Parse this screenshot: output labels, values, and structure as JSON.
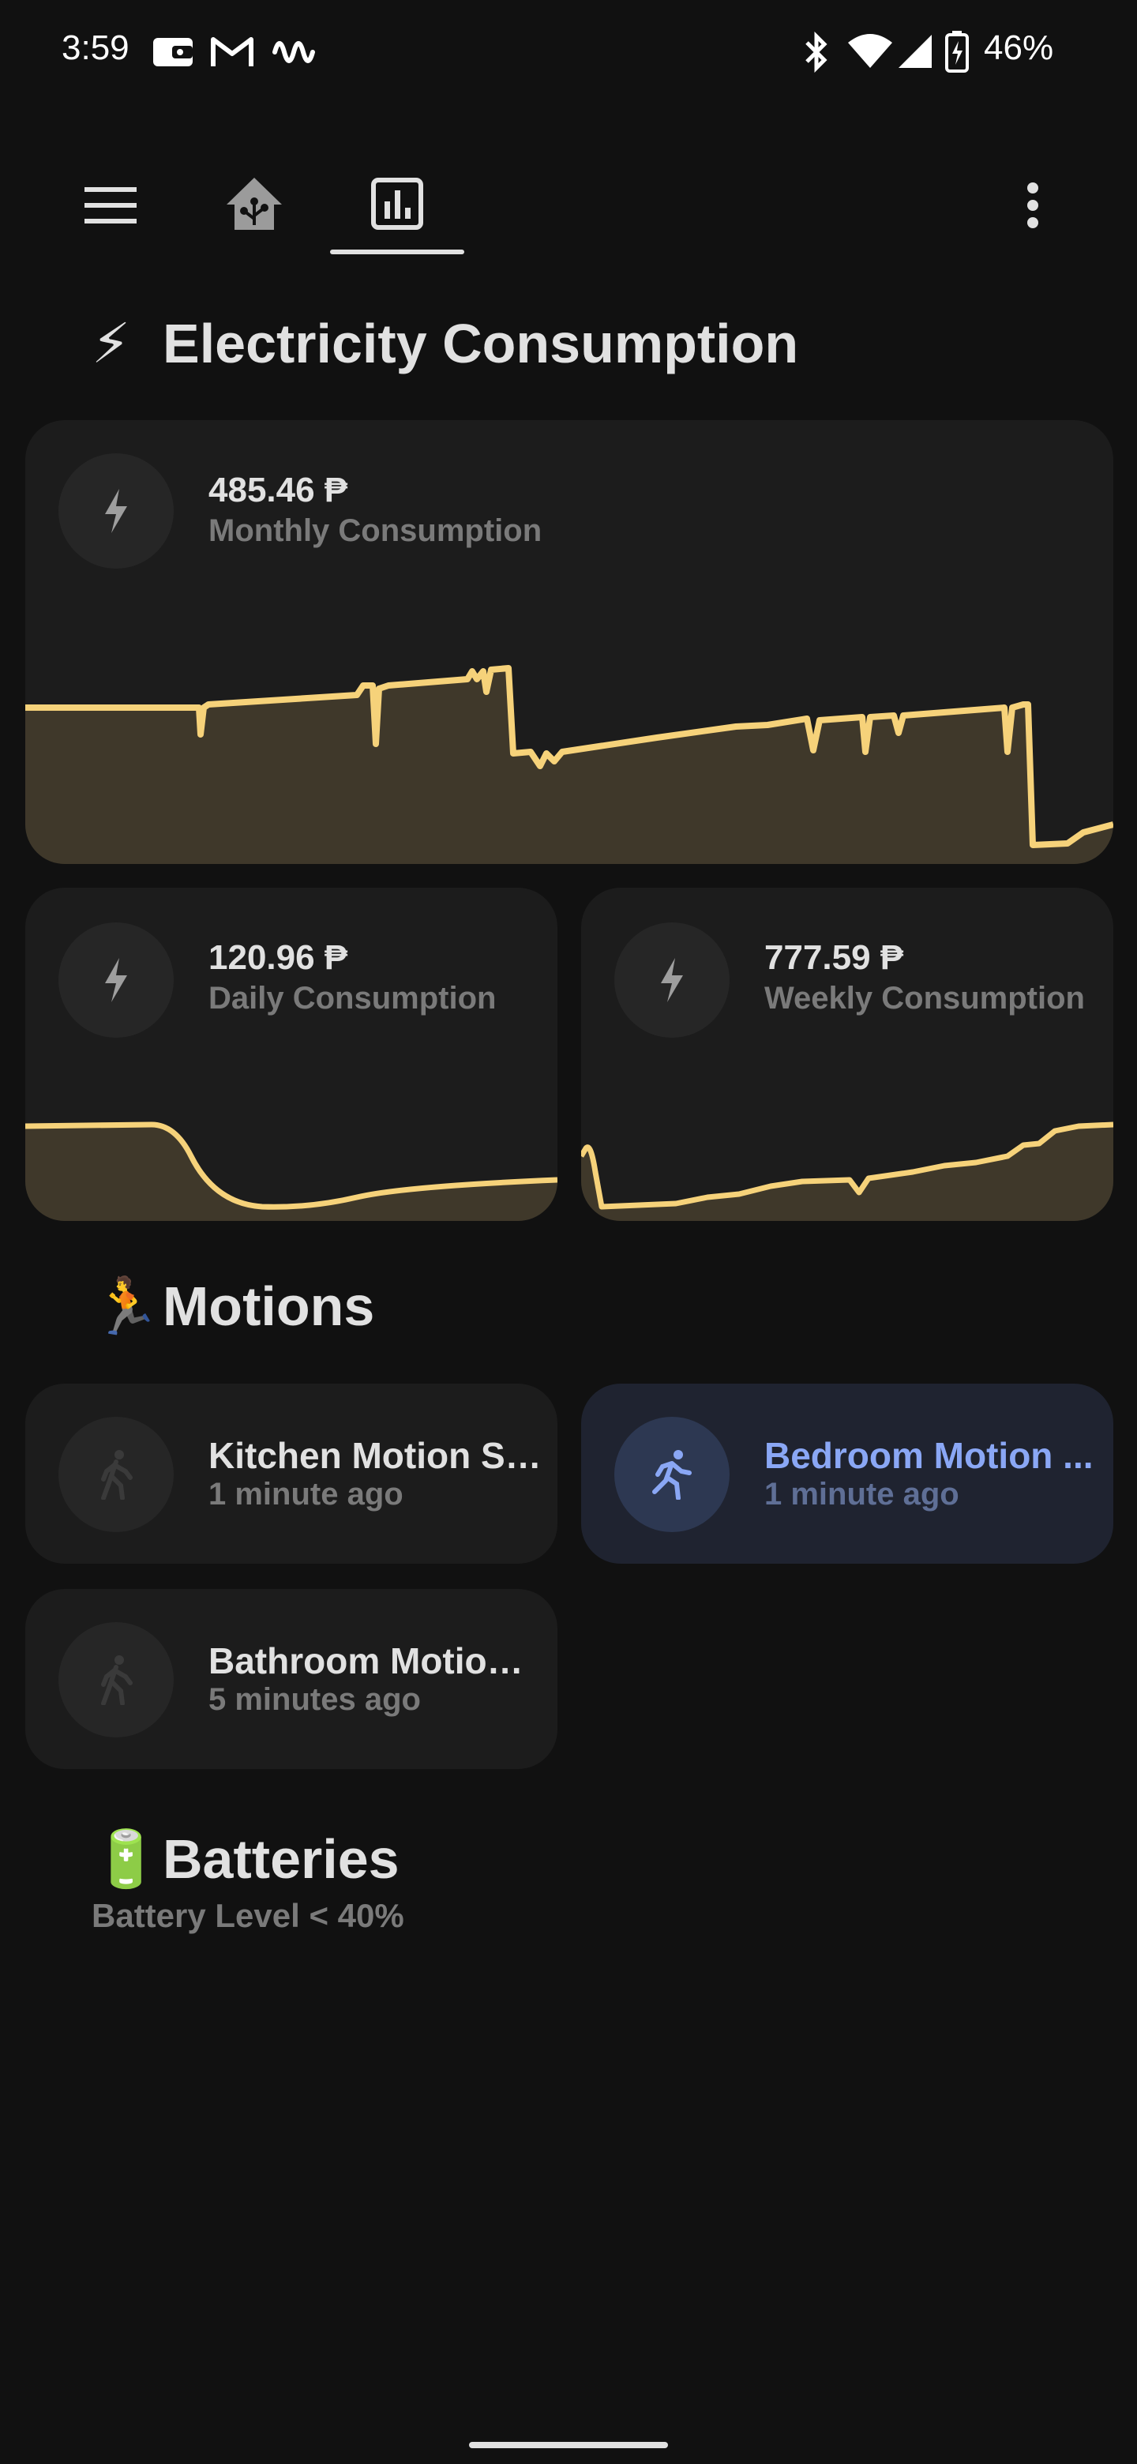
{
  "status_bar": {
    "time": "3:59",
    "battery_percent": "46%",
    "icons": [
      "wallet-icon",
      "gmail-icon",
      "assistant-icon",
      "bluetooth-icon",
      "wifi-icon",
      "signal-icon",
      "battery-charging-icon"
    ]
  },
  "toolbar": {
    "menu_icon": "hamburger-menu-icon",
    "tabs": [
      {
        "icon": "home-assistant-icon",
        "selected": false
      },
      {
        "icon": "chart-bar-icon",
        "selected": true
      }
    ],
    "overflow_icon": "more-vertical-icon"
  },
  "sections": {
    "electricity": {
      "emoji": "⚡",
      "title": "Electricity Consumption"
    },
    "motions": {
      "emoji": "🏃",
      "title": "Motions"
    },
    "batteries": {
      "emoji": "🔋",
      "title": "Batteries",
      "subtitle": "Battery Level < 40%"
    }
  },
  "electricity_cards": {
    "monthly": {
      "value": "485.46 ₱",
      "label": "Monthly Consumption",
      "icon": "lightning-bolt-icon"
    },
    "daily": {
      "value": "120.96 ₱",
      "label": "Daily Consumption",
      "icon": "lightning-bolt-icon"
    },
    "weekly": {
      "value": "777.59 ₱",
      "label": "Weekly Consumption",
      "icon": "lightning-bolt-icon"
    }
  },
  "motion_cards": [
    {
      "name": "Kitchen Motion Se...",
      "time": "1 minute ago",
      "active": false,
      "icon": "walk-icon"
    },
    {
      "name": "Bedroom Motion ...",
      "time": "1 minute ago",
      "active": true,
      "icon": "run-icon"
    },
    {
      "name": "Bathroom Motion ...",
      "time": "5 minutes ago",
      "active": false,
      "icon": "walk-icon"
    }
  ],
  "colors": {
    "background": "#111111",
    "card": "#1c1c1c",
    "graph_line": "#f6d27a",
    "graph_fill": "#3f382a",
    "active_accent": "#8aa7f5"
  }
}
